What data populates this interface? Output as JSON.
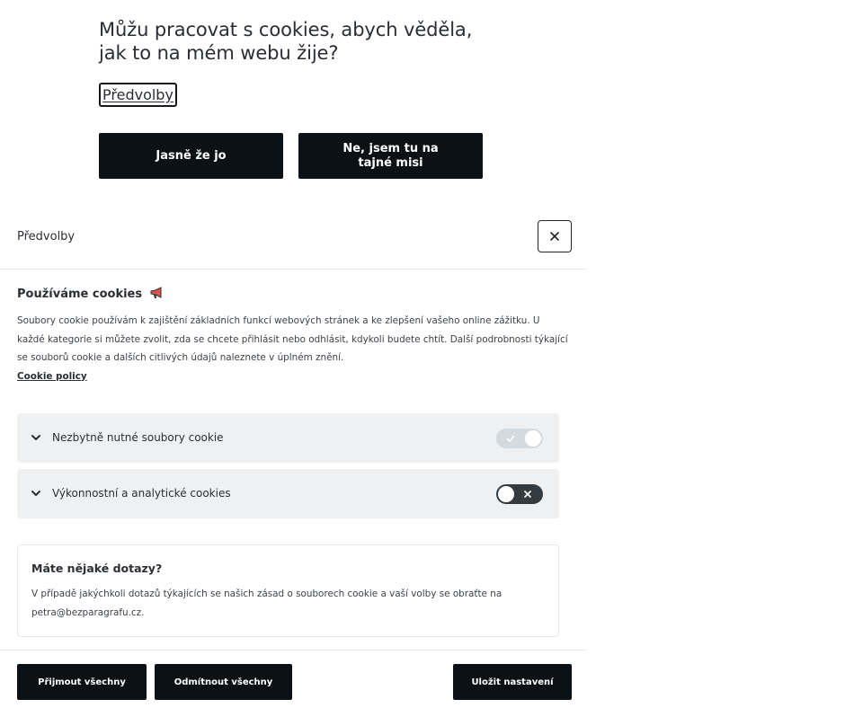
{
  "banner": {
    "question": "Můžu pracovat s cookies, abych věděla, jak to na mém webu žije?",
    "preferences_link": "Předvolby",
    "accept_label": "Jasně že jo",
    "reject_label": "Ne, jsem tu na tajné misi"
  },
  "modal": {
    "title": "Předvolby",
    "close_icon": "close-icon",
    "intro": {
      "heading": "Používáme cookies",
      "heading_icon": "megaphone-icon",
      "text": "Soubory cookie používám k zajištění základních funkcí webových stránek a ke zlepšení vašeho online zážitku. U každé kategorie si můžete zvolit, zda se chcete přihlásit nebo odhlásit, kdykoli budete chtít. Další podrobnosti týkající se souborů cookie a dalších citlivých údajů naleznete v úplném znění.",
      "policy_link": "Cookie policy"
    },
    "categories": [
      {
        "label": "Nezbytně nutné soubory cookie",
        "enabled": true,
        "locked": true
      },
      {
        "label": "Výkonnostní a analytické cookies",
        "enabled": false,
        "locked": false
      }
    ],
    "faq": {
      "title": "Máte nějaké dotazy?",
      "text": "V případě jakýchkoli dotazů týkajících se našich zásad o souborech cookie a vaší volby se obraťte na petra@bezparagrafu.cz."
    },
    "footer": {
      "accept_all": "Přijmout všechny",
      "reject_all": "Odmítnout všechny",
      "save": "Uložit nastavení"
    }
  },
  "colors": {
    "button_bg": "#0c1116",
    "category_bg": "#eef0f2",
    "toggle_on": "#d5dade",
    "toggle_off": "#353a3f"
  }
}
